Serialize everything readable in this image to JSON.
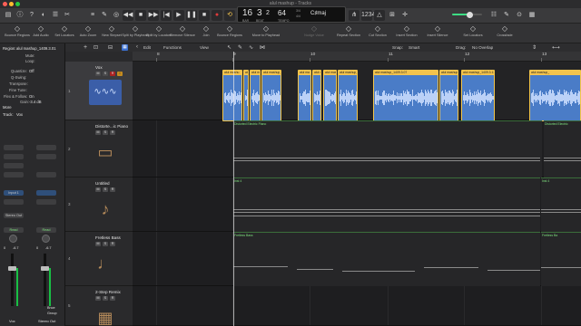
{
  "window": {
    "title": "alul mashup - Tracks"
  },
  "control_bar": {
    "buttons": [
      "library",
      "inspector",
      "smart-controls",
      "mixer",
      "editors",
      "rewind",
      "fast-forward",
      "go-to-start",
      "play",
      "stop",
      "record",
      "cycle"
    ],
    "lcd": {
      "bar": "16",
      "beat": "3",
      "division": "2",
      "tempo": "64",
      "time_sig": "3/4",
      "time_sig_sub": "4/4",
      "key": "C♯maj",
      "label_bar": "BAR",
      "label_beat": "BEAT",
      "label_tempo": "TEMPO"
    },
    "accent": "#3ddc84",
    "volume_level": 0.6
  },
  "toolbar": {
    "items": [
      {
        "label": "Bounce Regions",
        "icon": "bounce-icon"
      },
      {
        "label": "Add Audio",
        "icon": "add-audio-icon"
      },
      {
        "label": "Set Locators",
        "icon": "locators-icon"
      },
      {
        "label": "Auto Zoom",
        "icon": "zoom-icon"
      },
      {
        "label": "New Stepset",
        "icon": "step-icon"
      },
      {
        "label": "Split by Playhead",
        "icon": "split-icon"
      },
      {
        "label": "Split by Locators",
        "icon": "split-locators-icon"
      },
      {
        "label": "Remove Silence",
        "icon": "silence-icon"
      },
      {
        "label": "Join",
        "icon": "join-icon"
      },
      {
        "label": "Bounce Regions",
        "icon": "bounce-icon"
      },
      {
        "label": "Move to Playhead",
        "icon": "move-icon"
      },
      {
        "label": "Nudge Value",
        "icon": "nudge-icon",
        "dim": true
      },
      {
        "label": "Repeat Section",
        "icon": "repeat-icon"
      },
      {
        "label": "Cut Section",
        "icon": "cut-icon"
      },
      {
        "label": "Insert Section",
        "icon": "insert-icon"
      },
      {
        "label": "Insert Silence",
        "icon": "insert-silence-icon"
      },
      {
        "label": "Set Locators",
        "icon": "locators-icon"
      },
      {
        "label": "Crossfade",
        "icon": "crossfade-icon"
      }
    ]
  },
  "inspector": {
    "region_label": "Region:",
    "region_name": "alul mashup_1409.3.01",
    "rows": [
      {
        "label": "Mute:",
        "value": ""
      },
      {
        "label": "Loop:",
        "value": ""
      },
      {
        "label": "Quantize:",
        "value": "Off"
      },
      {
        "label": "Q-Swing:",
        "value": ""
      },
      {
        "label": "Transpose:",
        "value": ""
      },
      {
        "label": "Fine Tune:",
        "value": ""
      },
      {
        "label": "Flex & Follow:",
        "value": "On"
      },
      {
        "label": "Gain:",
        "value": "-3.4 dB"
      }
    ],
    "more_label": "More",
    "track_label": "Track:",
    "track_name": "Vox",
    "strip_left": {
      "input": "Input 1",
      "send": "Stereo Out",
      "read": "Read",
      "fader_value": "0",
      "pan_value": "-6.7",
      "name": "Vox"
    },
    "strip_right": {
      "input": "",
      "read": "Read",
      "fader_value": "0",
      "pan_value": "-6.7",
      "name": "Stereo Out"
    },
    "strip_left_level": 0.72,
    "strip_right_level": 0.72,
    "meter_color": "#18c044",
    "bounce_label": "Bnce",
    "group_label": "Group"
  },
  "edit_menu": {
    "items": [
      "Edit",
      "Functions",
      "View"
    ]
  },
  "track_header_top": {
    "label": "Percent ▾"
  },
  "snap": {
    "snap_label": "Snap:",
    "snap_value": "Smart",
    "drag_label": "Drag:",
    "drag_value": "No Overlap"
  },
  "ruler": {
    "marks": [
      "8",
      "9",
      "10",
      "11",
      "12",
      "13"
    ]
  },
  "tracks": [
    {
      "number": "1",
      "name": "Vox",
      "instrument_icon": "waveform-icon",
      "mute": "M",
      "solo": "S",
      "record": "R",
      "input": "I"
    },
    {
      "number": "2",
      "name": "Distorte...ic Piano",
      "instrument_icon": "electric-piano-icon",
      "mute": "M",
      "solo": "S",
      "record": "R"
    },
    {
      "number": "3",
      "name": "Untitled",
      "instrument_icon": "acoustic-guitar-icon",
      "mute": "M",
      "solo": "S",
      "record": "R"
    },
    {
      "number": "4",
      "name": "Fretless Bass",
      "instrument_icon": "electric-bass-icon",
      "mute": "M",
      "solo": "S",
      "record": "R"
    },
    {
      "number": "5",
      "name": "2-Step Remix",
      "instrument_icon": "drum-machine-icon",
      "mute": "M",
      "solo": "S",
      "record": "R"
    }
  ],
  "regions": {
    "vox": [
      {
        "name": "alul mashu",
        "color": "#4a7cc7"
      },
      {
        "name": "alul",
        "color": "#4a7cc7"
      },
      {
        "name": "alul mash",
        "color": "#4a7cc7"
      },
      {
        "name": "alul mashup_1409.3.06",
        "color": "#4a7cc7"
      },
      {
        "name": "alul ma",
        "color": "#4a7cc7"
      },
      {
        "name": "alul mash",
        "color": "#4a7cc7"
      },
      {
        "name": "alul mash",
        "color": "#4a7cc7"
      },
      {
        "name": "alul mashup_1409.3.07",
        "color": "#4a7cc7"
      },
      {
        "name": "alul mashup_1",
        "color": "#4a7cc7"
      },
      {
        "name": "alul mashup_1409.3.13",
        "color": "#4a7cc7"
      },
      {
        "name": "alul mashup_",
        "color": "#4a7cc7"
      }
    ],
    "piano": [
      {
        "name": "Distorted Electric Piano"
      },
      {
        "name": "Distorted Electric"
      }
    ],
    "guitar": [
      {
        "name": "Inst 4"
      },
      {
        "name": "Inst 4"
      }
    ],
    "bass": [
      {
        "name": "Fretless Bass"
      },
      {
        "name": "Fretless Ba"
      }
    ]
  },
  "colors": {
    "region_header": "#f3c34d",
    "midi_name": "#7ee07e",
    "record": "#aa2222"
  }
}
